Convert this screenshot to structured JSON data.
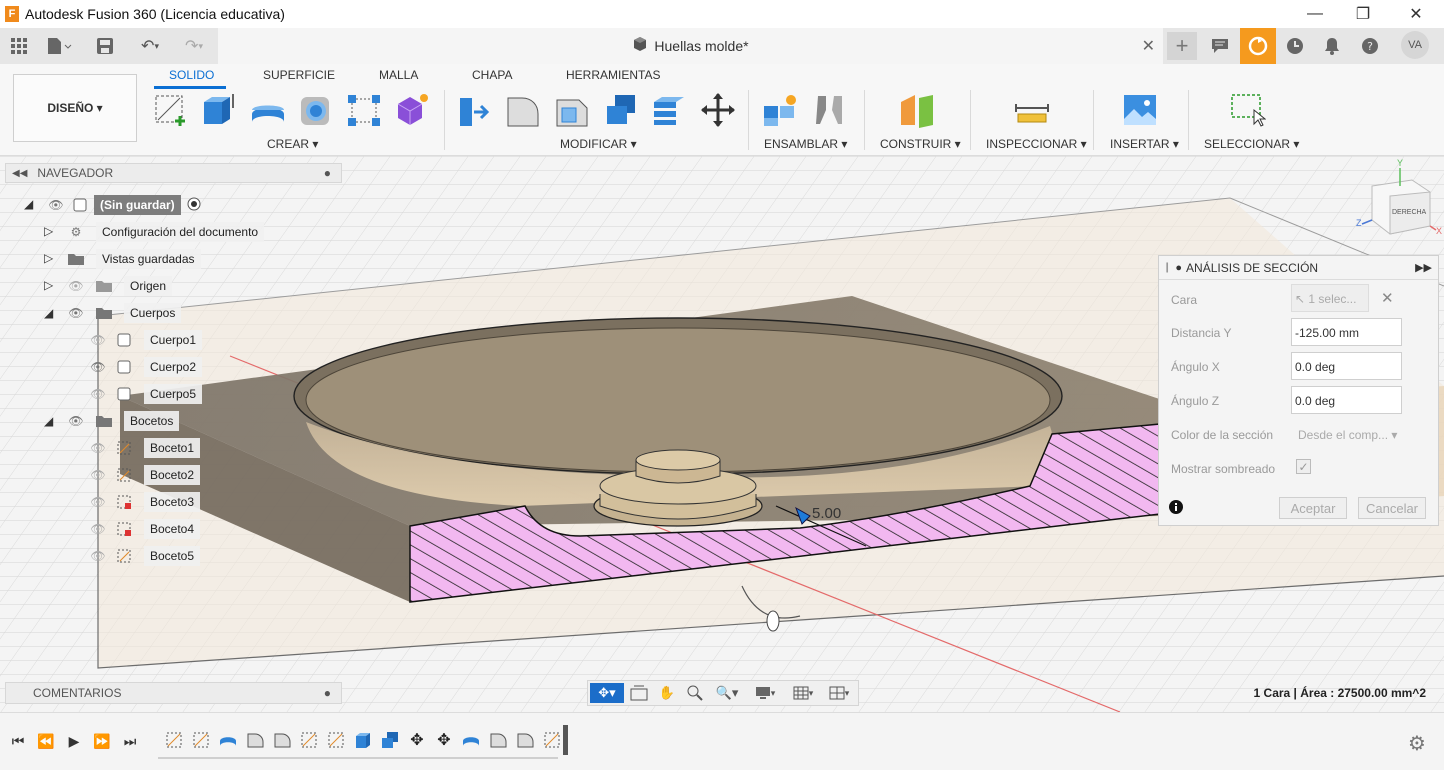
{
  "window": {
    "title": "Autodesk Fusion 360 (Licencia educativa)",
    "logo_letter": "F"
  },
  "document": {
    "tab_title": "Huellas molde*"
  },
  "user": {
    "initials": "VA"
  },
  "ribbon": {
    "workspace": "DISEÑO ▾",
    "tabs": [
      "SOLIDO",
      "SUPERFICIE",
      "MALLA",
      "CHAPA",
      "HERRAMIENTAS"
    ],
    "active_tab": "SOLIDO",
    "groups": {
      "crear": "CREAR ▾",
      "modificar": "MODIFICAR ▾",
      "ensamblar": "ENSAMBLAR ▾",
      "construir": "CONSTRUIR ▾",
      "inspeccionar": "INSPECCIONAR ▾",
      "insertar": "INSERTAR ▾",
      "seleccionar": "SELECCIONAR ▾"
    }
  },
  "navigator": {
    "title": "NAVEGADOR",
    "root": "(Sin guardar)",
    "items": {
      "config": "Configuración del documento",
      "vistas": "Vistas guardadas",
      "origen": "Origen",
      "cuerpos": "Cuerpos",
      "cuerpo1": "Cuerpo1",
      "cuerpo2": "Cuerpo2",
      "cuerpo5": "Cuerpo5",
      "bocetos": "Bocetos",
      "boceto1": "Boceto1",
      "boceto2": "Boceto2",
      "boceto3": "Boceto3",
      "boceto4": "Boceto4",
      "boceto5": "Boceto5"
    }
  },
  "section_panel": {
    "title": "ANÁLISIS DE SECCIÓN",
    "fields": {
      "cara_label": "Cara",
      "cara_value": "1 selec...",
      "distancia_label": "Distancia Y",
      "distancia_value": "-125.00 mm",
      "angx_label": "Ángulo X",
      "angx_value": "0.0 deg",
      "angz_label": "Ángulo Z",
      "angz_value": "0.0 deg",
      "color_label": "Color de la sección",
      "color_value": "Desde el comp... ▾",
      "sombreado_label": "Mostrar sombreado",
      "sombreado_checked": true
    },
    "ok": "Aceptar",
    "cancel": "Cancelar"
  },
  "viewcube": {
    "face": "DERECHA",
    "axes": [
      "Y",
      "Z",
      "X"
    ]
  },
  "viewport": {
    "dimension_value": "5.00"
  },
  "comments": {
    "label": "COMENTARIOS"
  },
  "status": {
    "text": "1 Cara | Área : 27500.00 mm^2"
  },
  "colors": {
    "accent": "#0b6fd3",
    "hatch": "#f2b8f0",
    "body": "#8d7a63",
    "orange": "#f59a1e"
  }
}
